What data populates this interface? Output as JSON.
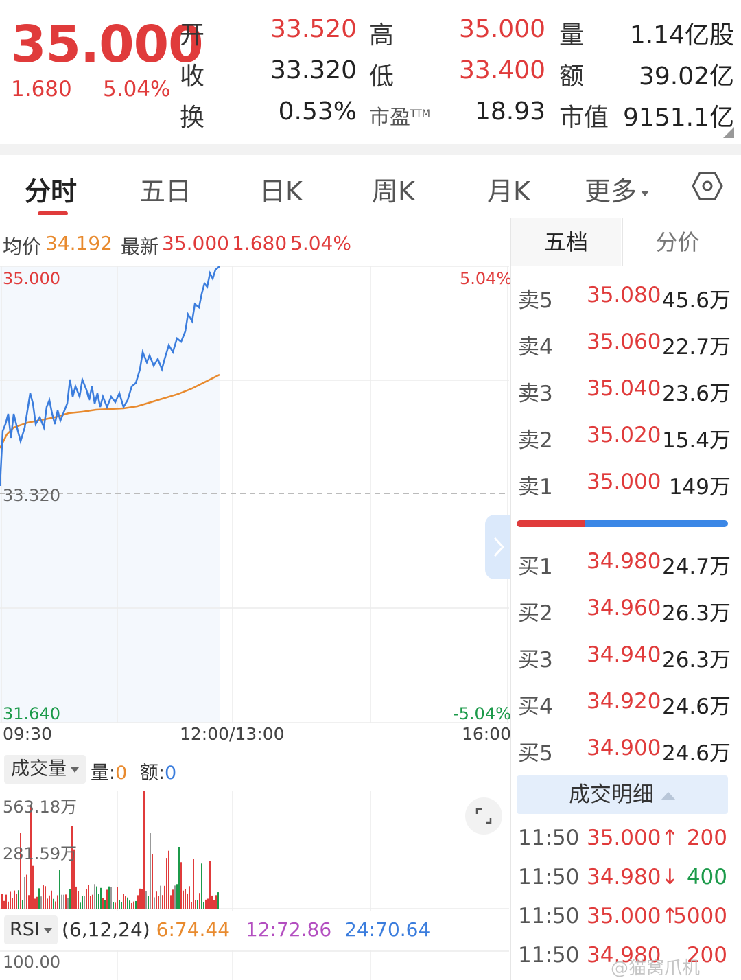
{
  "quote": {
    "price": "35.000",
    "change": "1.680",
    "change_pct": "5.04%",
    "open_label": "开",
    "open": "33.520",
    "high_label": "高",
    "high": "35.000",
    "volume_label": "量",
    "volume": "1.14亿股",
    "close_label": "收",
    "close": "33.320",
    "low_label": "低",
    "low": "33.400",
    "amount_label": "额",
    "amount": "39.02亿",
    "turnover_label": "换",
    "turnover": "0.53%",
    "pe_label": "市盈",
    "pe_sup": "TTM",
    "pe": "18.93",
    "mktcap_label": "市值",
    "mktcap": "9151.1亿"
  },
  "tabs": [
    {
      "label": "分时"
    },
    {
      "label": "五日"
    },
    {
      "label": "日K"
    },
    {
      "label": "周K"
    },
    {
      "label": "月K"
    },
    {
      "label": "更多"
    }
  ],
  "chart_info": {
    "avg_label": "均价",
    "avg": "34.192",
    "last_label": "最新",
    "last": "35.000",
    "last_chg": "1.680",
    "last_pct": "5.04%"
  },
  "price_axis": {
    "top": "35.000",
    "mid": "33.320",
    "bottom": "31.640",
    "top_pct": "5.04%",
    "bottom_pct": "-5.04%"
  },
  "time_axis": {
    "start": "09:30",
    "mid": "12:00/13:00",
    "end": "16:00"
  },
  "volume_panel": {
    "selector": "成交量",
    "vol_label": "量:",
    "vol": "0",
    "amt_label": "额:",
    "amt": "0",
    "tick_high": "563.18万",
    "tick_mid": "281.59万"
  },
  "rsi_panel": {
    "selector": "RSI",
    "params": "(6,12,24)",
    "rsi6": "6:74.44",
    "rsi12": "12:72.86",
    "rsi24": "24:70.64",
    "tick_top": "100.00"
  },
  "order_book": {
    "tabs": [
      {
        "label": "五档"
      },
      {
        "label": "分价"
      }
    ],
    "asks": [
      {
        "label": "卖5",
        "price": "35.080",
        "vol": "45.6万"
      },
      {
        "label": "卖4",
        "price": "35.060",
        "vol": "22.7万"
      },
      {
        "label": "卖3",
        "price": "35.040",
        "vol": "23.6万"
      },
      {
        "label": "卖2",
        "price": "35.020",
        "vol": "15.4万"
      },
      {
        "label": "卖1",
        "price": "35.000",
        "vol": "149万"
      }
    ],
    "bids": [
      {
        "label": "买1",
        "price": "34.980",
        "vol": "24.7万"
      },
      {
        "label": "买2",
        "price": "34.960",
        "vol": "26.3万"
      },
      {
        "label": "买3",
        "price": "34.940",
        "vol": "26.3万"
      },
      {
        "label": "买4",
        "price": "34.920",
        "vol": "24.6万"
      },
      {
        "label": "买5",
        "price": "34.900",
        "vol": "24.6万"
      }
    ]
  },
  "trade_detail": {
    "title": "成交明细",
    "rows": [
      {
        "time": "11:50",
        "price": "35.000↑",
        "vol": "200",
        "side": "buy"
      },
      {
        "time": "11:50",
        "price": "34.980↓",
        "vol": "400",
        "side": "sell"
      },
      {
        "time": "11:50",
        "price": "35.000↑",
        "vol": "5000",
        "side": "buy"
      },
      {
        "time": "11:50",
        "price": "34.980",
        "vol": "200",
        "side": "buy"
      }
    ]
  },
  "watermark": "@猫窝爪机",
  "colors": {
    "up": "#e03b3b",
    "down": "#1c9a4a",
    "price_line": "#3b7ddd",
    "avg_line": "#e88a2e"
  }
}
